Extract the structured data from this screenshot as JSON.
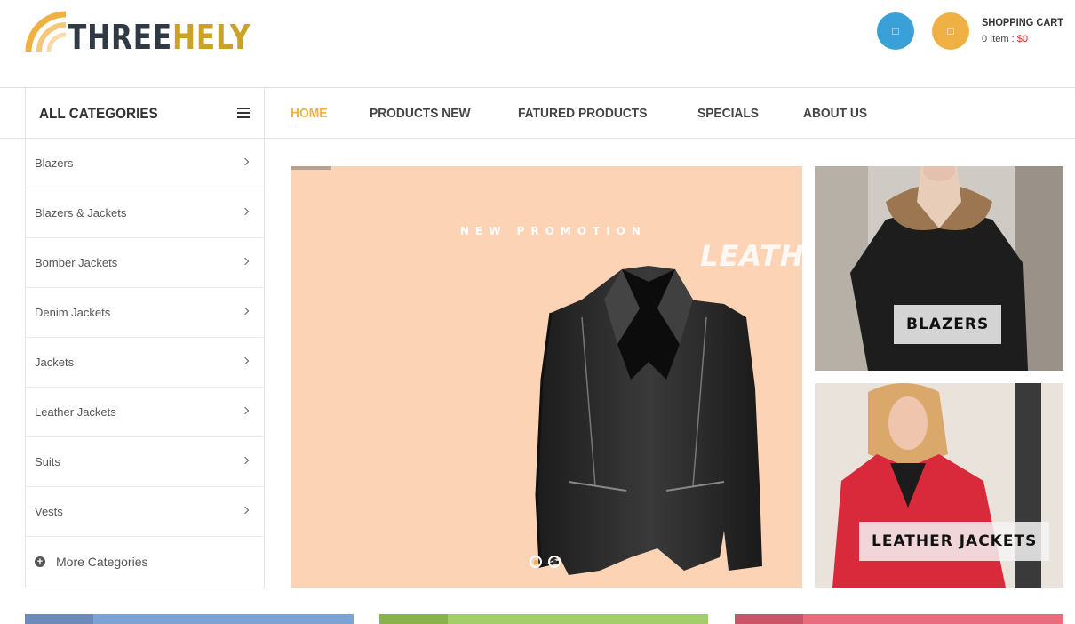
{
  "brand": {
    "logo_dark": "THREE",
    "logo_gold": "HELY"
  },
  "header": {
    "user_icon": "user-icon",
    "cart_icon": "cart-icon",
    "cart_title": "SHOPPING CART",
    "cart_items": "0 Item : ",
    "cart_total": "$0"
  },
  "categories": {
    "heading": "ALL CATEGORIES",
    "items": [
      {
        "label": "Blazers"
      },
      {
        "label": "Blazers & Jackets"
      },
      {
        "label": "Bomber Jackets"
      },
      {
        "label": "Denim Jackets"
      },
      {
        "label": "Jackets"
      },
      {
        "label": "Leather Jackets"
      },
      {
        "label": "Suits"
      },
      {
        "label": "Vests"
      }
    ],
    "more": "More Categories"
  },
  "menu": {
    "items": [
      {
        "label": "HOME",
        "active": true
      },
      {
        "label": "PRODUCTS NEW"
      },
      {
        "label": "FATURED PRODUCTS"
      },
      {
        "label": "SPECIALS"
      },
      {
        "label": "ABOUT US"
      }
    ]
  },
  "slider": {
    "promo_text": "NEW PROMOTION",
    "headline": "LEATHE",
    "slide_count": 2,
    "active_slide": 1
  },
  "banners": [
    {
      "label": "BLAZERS"
    },
    {
      "label": "LEATHER JACKETS"
    }
  ],
  "colors": {
    "accent": "#f0b144",
    "user_button": "#3aa0d8",
    "slider_bg": "#fdd3b6",
    "price": "#e02020"
  }
}
